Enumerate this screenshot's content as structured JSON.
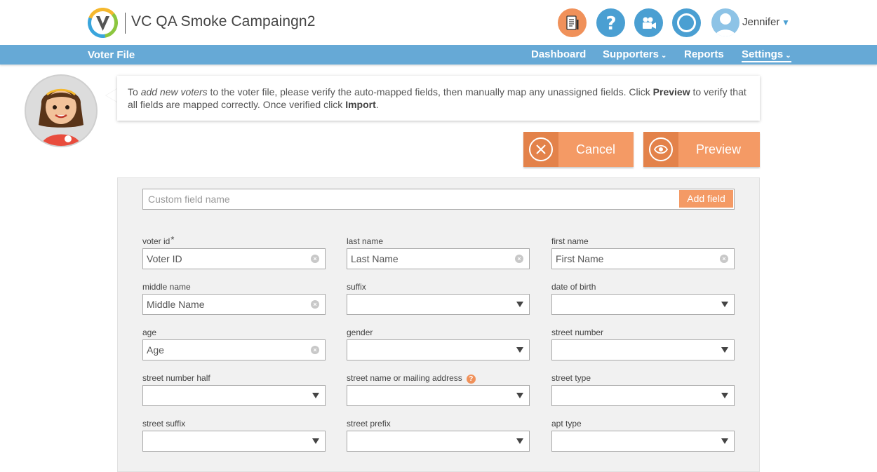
{
  "header": {
    "app_title": "VC QA Smoke Campaingn2",
    "user_name": "Jennifer",
    "icons": [
      "clipboard-icon",
      "help-icon",
      "video-camera-icon",
      "circle-icon"
    ]
  },
  "nav": {
    "brand": "Voter File",
    "items": [
      {
        "label": "Dashboard",
        "has_dropdown": false,
        "active": false
      },
      {
        "label": "Supporters",
        "has_dropdown": true,
        "active": false
      },
      {
        "label": "Reports",
        "has_dropdown": false,
        "active": false
      },
      {
        "label": "Settings",
        "has_dropdown": true,
        "active": true
      }
    ]
  },
  "instructions": {
    "part1": "To ",
    "em1": "add new voters",
    "part2": " to the voter file, please verify the auto-mapped fields, then manually map any unassigned fields. Click ",
    "b1": "Preview",
    "part3": " to verify that all fields are mapped correctly. Once verified click ",
    "b2": "Import",
    "part4": "."
  },
  "actions": {
    "cancel_label": "Cancel",
    "preview_label": "Preview"
  },
  "custom_field": {
    "placeholder": "Custom field name",
    "add_label": "Add field"
  },
  "fields": {
    "voter_id": {
      "label": "voter id",
      "required_mark": "*",
      "value": "Voter ID"
    },
    "last_name": {
      "label": "last name",
      "value": "Last Name"
    },
    "first_name": {
      "label": "first name",
      "value": "First Name"
    },
    "middle_name": {
      "label": "middle name",
      "value": "Middle Name"
    },
    "suffix": {
      "label": "suffix"
    },
    "date_of_birth": {
      "label": "date of birth"
    },
    "age": {
      "label": "age",
      "value": "Age"
    },
    "gender": {
      "label": "gender"
    },
    "street_number": {
      "label": "street number"
    },
    "street_number_half": {
      "label": "street number half"
    },
    "street_name": {
      "label": "street name or mailing address",
      "help": "?"
    },
    "street_type": {
      "label": "street type"
    },
    "street_suffix": {
      "label": "street suffix"
    },
    "street_prefix": {
      "label": "street prefix"
    },
    "apt_type": {
      "label": "apt type"
    }
  },
  "colors": {
    "accent_orange": "#f49a65",
    "nav_blue": "#66a9d6",
    "icon_blue": "#4a9fd2"
  }
}
